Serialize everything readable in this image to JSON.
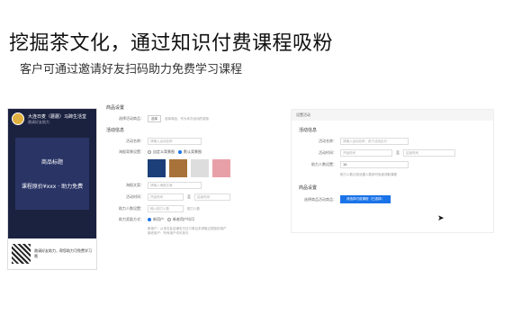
{
  "heading": {
    "title": "挖掘茶文化，通过知识付费课程吸粉",
    "subtitle": "客户可通过邀请好友扫码助力免费学习课程"
  },
  "phone": {
    "name": "大连日麦（蘑蘑）马蹄生活堂",
    "sub": "邀请好友助力",
    "product": "商品标题",
    "help_text": "课程原价¥xxx · 助力免费",
    "bottom": "邀请好友助力，帮您助力可免费学习哦"
  },
  "form1": {
    "section1": "商品设置",
    "row_select_label": "选择活动商品：",
    "row_select_btn": "选择",
    "row_select_hint": "选择商品，作为本次活动的奖励",
    "section2": "活动信息",
    "name_label": "活动名称：",
    "name_ph": "请输入活动名称",
    "poster_label": "海报背景设置：",
    "poster_opt1": "自定义背景图",
    "poster_opt2": "默认背景图",
    "title_label": "海报文案：",
    "title_ph": "请输入海报文案",
    "time_label": "活动时间：",
    "time_start": "开始时间",
    "time_to": "至",
    "time_end": "结束时间",
    "count_label": "助力人数设置：",
    "count_ph": "输入助力人数",
    "count_hint": "助力人数",
    "target_label": "助力奖励方式：",
    "target_opt1": "新用户",
    "target_opt2": "新老用户均可",
    "hint1": "新用户：从未在此店铺支付过订单且未领取过奖励的用户",
    "hint2": "新老用户：所有用户均可参与"
  },
  "form2": {
    "top": "设置活动",
    "section1": "活动信息",
    "name_label": "活动名称：",
    "name_ph": "请输入活动名称，用于活动区分",
    "time_label": "活动时间：",
    "time_start": "开始时间",
    "time_to": "至",
    "time_end": "结束时间",
    "count_label": "助力人数设置：",
    "count_val": "10",
    "count_hint": "助力人数达到设置人数即可免费领取课程",
    "section2": "商品设置",
    "select_label": "选择商品活动商品：",
    "select_btn": "请选择付费课程（已选择）"
  },
  "colors": {
    "accent": "#1a73e8",
    "phone_bg": "#1b2240"
  }
}
